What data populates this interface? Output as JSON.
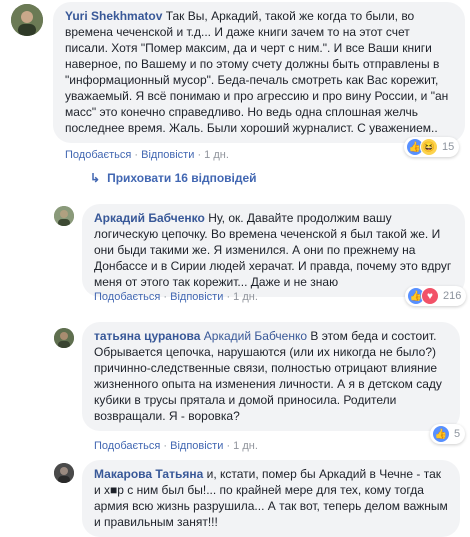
{
  "actions": {
    "like": "Подобається",
    "reply": "Відповісти",
    "separator": "·"
  },
  "comments": [
    {
      "author": "Yuri Shekhmatov",
      "text": "Так Вы, Аркадий, такой же когда то были, во времена чеченской и т.д... И даже книги зачем то на этот счет писали. Хотя \"Помер максим, да и черт с ним.\". И все Ваши книги наверное, по Вашему и по этому счету должны быть отправлены в \"информационный мусор\". Беда-печаль смотреть как Вас корежит, уважаемый. Я всё понимаю и про агрессию и про вину России, и \"ан масс\" это конечно справедливо. Но ведь одна сплошная желчь последнее время. Жаль. Были хороший журналист. С уважением..",
      "time": "1 дн.",
      "reactions": [
        "like",
        "haha"
      ],
      "reaction_count": "15"
    },
    {
      "author": "Аркадий Бабченко",
      "text": "Ну, ок. Давайте продолжим вашу логическую цепочку. Во времена чеченской я был такой же. И они быди такими же. Я изменился. А они по прежнему на Донбассе и в Сирии людей херачат. И правда, почему это вдруг меня от этого так корежит... Даже и не знаю",
      "time": "1 дн.",
      "reactions": [
        "like",
        "love"
      ],
      "reaction_count": "216"
    },
    {
      "author": "татьяна цуранова",
      "mention": "Аркадий Бабченко",
      "text": "В этом беда и состоит. Обрывается цепочка, нарушаются (или их никогда не было?) причинно-следственные связи, полностью отрицают влияние жизненного опыта на изменения личности. А я в детском саду кубики в трусы прятала и домой приносила. Родители возвращали. Я - воровка?",
      "time": "1 дн.",
      "reactions": [
        "like"
      ],
      "reaction_count": "5"
    },
    {
      "author": "Макарова Татьяна",
      "text": "и, кстати, помер бы Аркадий в Чечне - так и х■р с ним был бы!... по крайней мере для тех, кому тогда армия всю жизнь разрушила... А так вот, теперь делом важным и правильным занят!!!"
    }
  ],
  "hide_replies_label": "Приховати 16 відповідей"
}
